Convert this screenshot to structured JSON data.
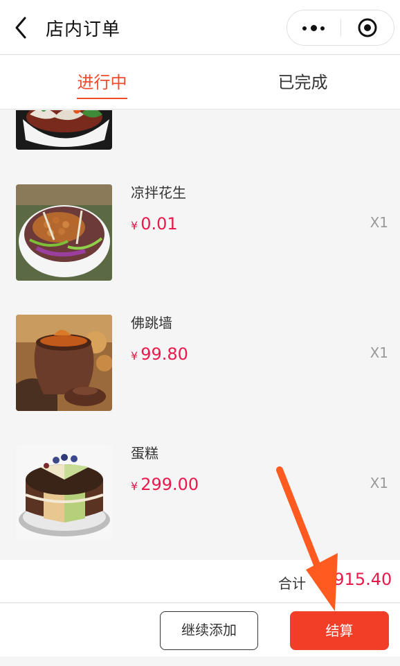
{
  "navbar": {
    "title": "店内订单"
  },
  "tabs": [
    {
      "label": "进行中",
      "active": true
    },
    {
      "label": "已完成",
      "active": false
    }
  ],
  "items": [
    {
      "name": "凉拌花生",
      "currency": "¥",
      "price": "0.01",
      "qty": "X1",
      "image": "peanut-salad"
    },
    {
      "name": "佛跳墙",
      "currency": "¥",
      "price": "99.80",
      "qty": "X1",
      "image": "buddha-jumps-wall"
    },
    {
      "name": "蛋糕",
      "currency": "¥",
      "price": "299.00",
      "qty": "X1",
      "image": "cake"
    }
  ],
  "summary": {
    "label": "合计",
    "currency": "¥",
    "amount": "915.40"
  },
  "actions": {
    "continue_label": "继续添加",
    "settle_label": "结算"
  },
  "colors": {
    "accent": "#f04a2b",
    "price": "#e8194b",
    "button": "#f23d27",
    "annotation_arrow": "#ff5a1f"
  }
}
